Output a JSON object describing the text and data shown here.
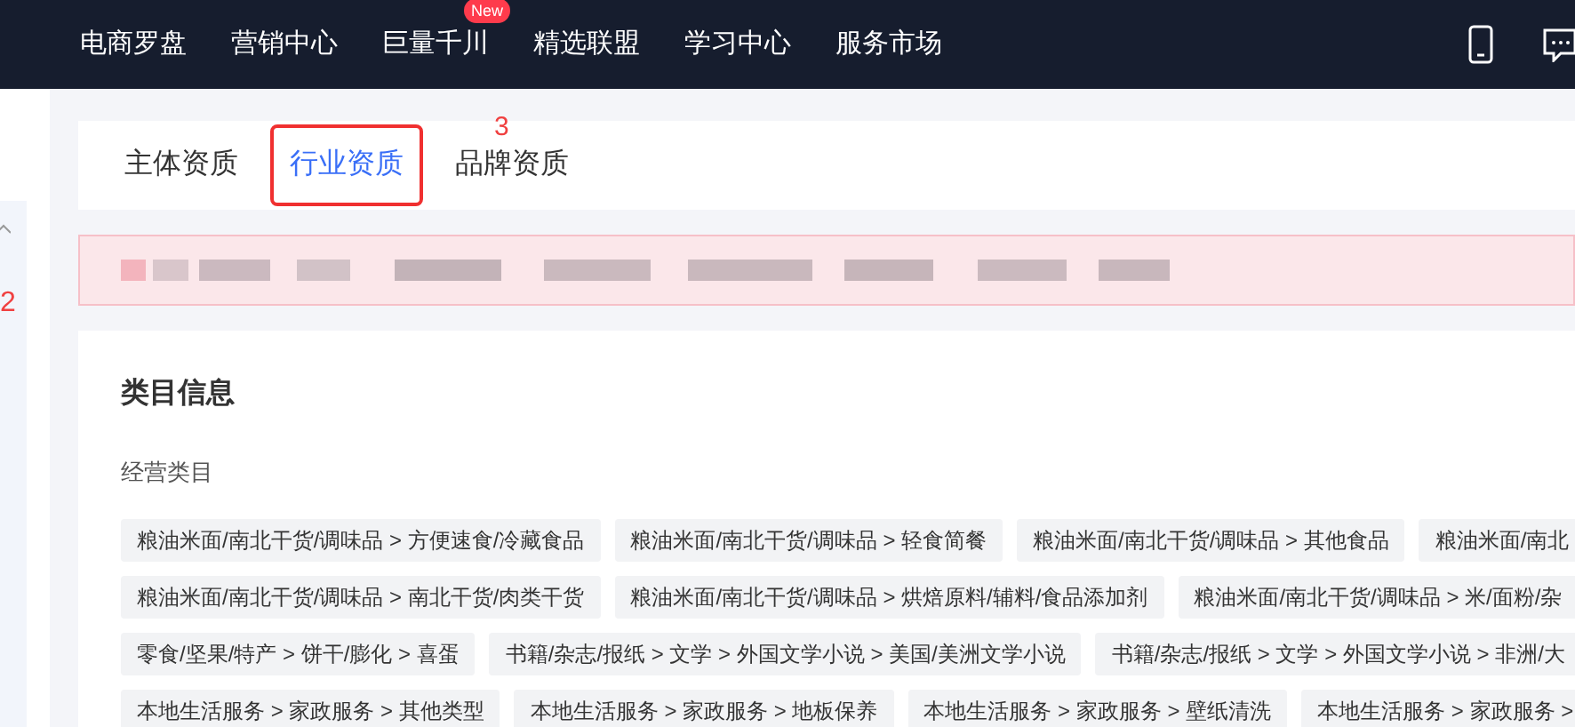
{
  "nav": {
    "items": [
      {
        "label": "电商罗盘"
      },
      {
        "label": "营销中心"
      },
      {
        "label": "巨量千川",
        "badge": "New"
      },
      {
        "label": "精选联盟"
      },
      {
        "label": "学习中心"
      },
      {
        "label": "服务市场"
      }
    ]
  },
  "sidebar": {
    "annotation": "2"
  },
  "tabs": [
    {
      "label": "主体资质",
      "selected": false,
      "annotated": false
    },
    {
      "label": "行业资质",
      "selected": true,
      "annotated": true
    },
    {
      "label": "品牌资质",
      "selected": false,
      "annotated": false
    }
  ],
  "tabs_annotation": "3",
  "category_card": {
    "title": "类目信息",
    "section_label": "经营类目",
    "tag_rows": [
      [
        "粮油米面/南北干货/调味品 > 方便速食/冷藏食品",
        "粮油米面/南北干货/调味品 > 轻食简餐",
        "粮油米面/南北干货/调味品 > 其他食品",
        "粮油米面/南北"
      ],
      [
        "粮油米面/南北干货/调味品 > 南北干货/肉类干货",
        "粮油米面/南北干货/调味品 > 烘焙原料/辅料/食品添加剂",
        "粮油米面/南北干货/调味品 > 米/面粉/杂"
      ],
      [
        "零食/坚果/特产 > 饼干/膨化 > 喜蛋",
        "书籍/杂志/报纸 > 文学 > 外国文学小说 > 美国/美洲文学小说",
        "书籍/杂志/报纸 > 文学 > 外国文学小说 > 非洲/大"
      ],
      [
        "本地生活服务 > 家政服务 > 其他类型",
        "本地生活服务 > 家政服务 > 地板保养",
        "本地生活服务 > 家政服务 > 壁纸清洗",
        "本地生活服务 > 家政服务 >"
      ]
    ]
  }
}
